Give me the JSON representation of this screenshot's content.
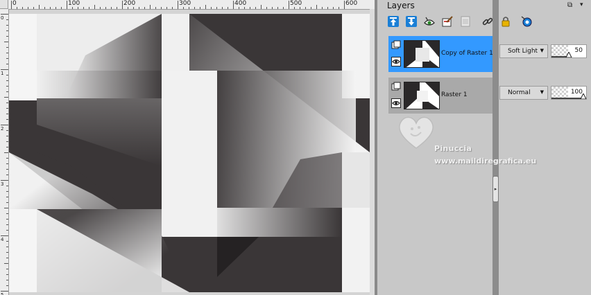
{
  "panel": {
    "title": "Layers",
    "pin_glyph": "⧉",
    "menu_glyph": "▾"
  },
  "toolbar": {
    "icons": [
      "move-layer-up-icon",
      "move-layer-down-icon",
      "layer-visibility-toggle-icon",
      "layer-properties-icon",
      "delete-layer-icon",
      "link-layers-icon",
      "lock-layer-icon",
      "mask-icon"
    ]
  },
  "ruler": {
    "labels": [
      "0",
      "100",
      "200",
      "300",
      "400",
      "500",
      "600"
    ],
    "vertical_labels": [
      "0",
      "1",
      "2",
      "3",
      "4",
      "5"
    ]
  },
  "layers": [
    {
      "name": "Copy of Raster 1",
      "blend_mode": "Soft Light",
      "opacity": "50",
      "opacity_fraction": 0.5,
      "selected": true
    },
    {
      "name": "Raster 1",
      "blend_mode": "Normal",
      "opacity": "100",
      "opacity_fraction": 1.0,
      "selected": false
    }
  ],
  "watermark": {
    "name": "Pinuccia",
    "url": "www.maildiregrafica.eu"
  },
  "colors": {
    "selection": "#3399ff",
    "canvas_dark": "#3a3637",
    "canvas_light": "#f1f1f1"
  }
}
